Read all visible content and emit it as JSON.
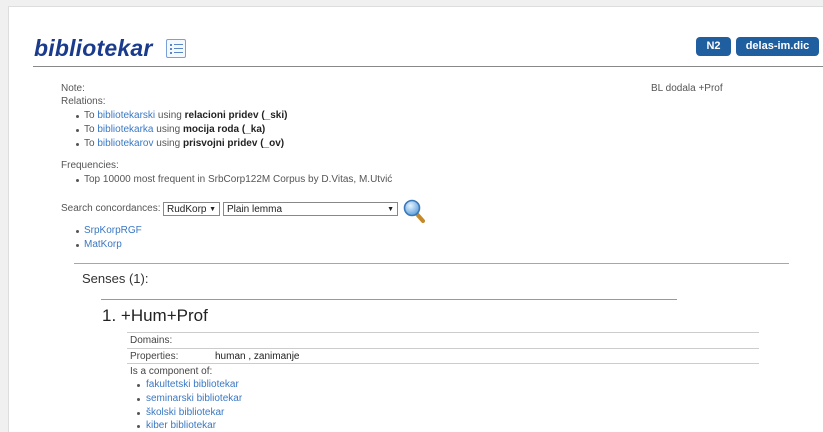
{
  "header": {
    "title": "bibliotekar",
    "buttons": {
      "n2": "N2",
      "dic": "delas-im.dic"
    }
  },
  "meta": {
    "note_label": "Note:",
    "note_value": "BL dodala +Prof",
    "relations_label": "Relations:"
  },
  "relations": [
    {
      "prefix": "To ",
      "target": "bibliotekarski",
      "middle": " using ",
      "kind": "relacioni pridev (_ski)"
    },
    {
      "prefix": "To ",
      "target": "bibliotekarka",
      "middle": " using ",
      "kind": "mocija roda (_ka)"
    },
    {
      "prefix": "To ",
      "target": "bibliotekarov",
      "middle": " using ",
      "kind": "prisvojni pridev (_ov)"
    }
  ],
  "frequencies": {
    "label": "Frequencies:",
    "item": "Top 10000 most frequent in SrbCorp122M Corpus by D.Vitas, M.Utvić"
  },
  "search": {
    "label": "Search concordances:",
    "corpus_select": "RudKorp",
    "mode_select": "Plain lemma",
    "links": [
      "SrpKorpRGF",
      "MatKorp"
    ]
  },
  "senses": {
    "heading": "Senses (1):",
    "items": [
      {
        "title": "1. +Hum+Prof",
        "domains_label": "Domains:",
        "properties_label": "Properties:",
        "properties_value": "human , zanimanje",
        "component_label": "Is a component of:",
        "components": [
          "fakultetski bibliotekar",
          "seminarski bibliotekar",
          "školski bibliotekar",
          "kiber bibliotekar"
        ]
      }
    ]
  }
}
